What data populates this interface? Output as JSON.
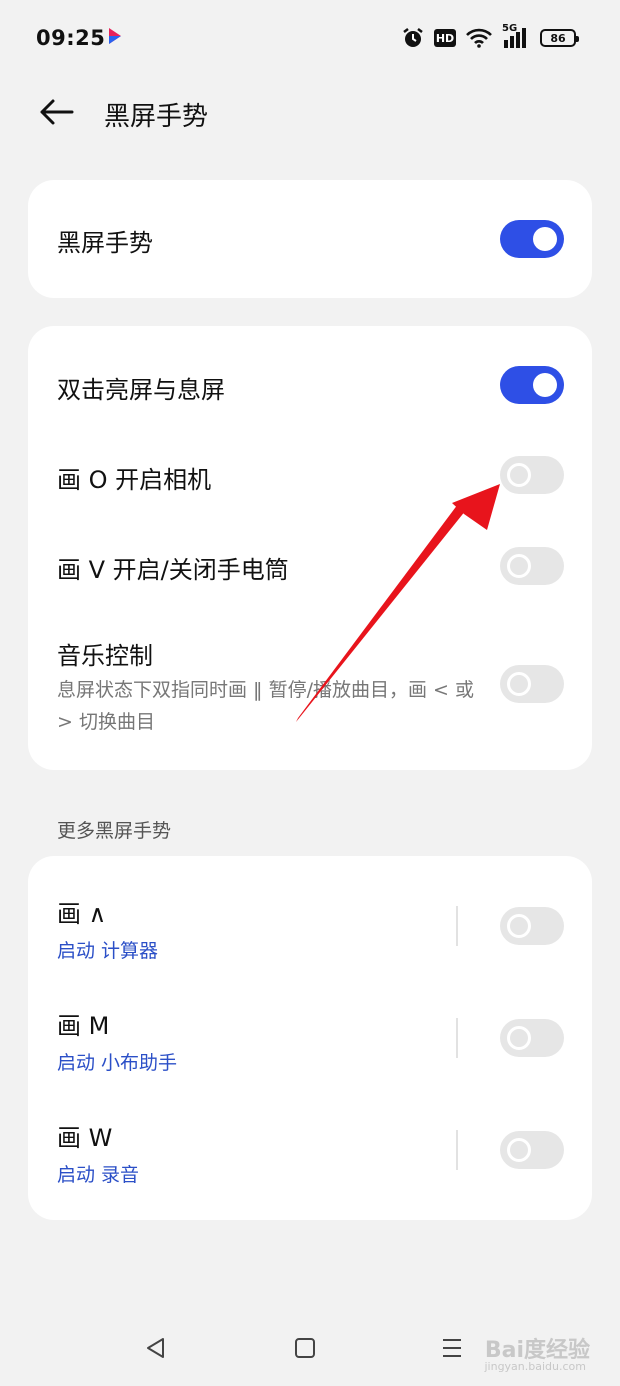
{
  "status": {
    "time": "09:25",
    "signal": "5G",
    "hd": "HD",
    "battery": "86"
  },
  "header": {
    "title": "黑屏手势"
  },
  "master": {
    "label": "黑屏手势",
    "enabled": true
  },
  "gestures": [
    {
      "label": "双击亮屏与息屏",
      "enabled": true
    },
    {
      "label": "画 O 开启相机",
      "enabled": false
    },
    {
      "label": "画 V 开启/关闭手电筒",
      "enabled": false
    },
    {
      "label": "音乐控制",
      "desc": "息屏状态下双指同时画 ‖ 暂停/播放曲目，画 < 或 > 切换曲目",
      "enabled": false
    }
  ],
  "more": {
    "section_label": "更多黑屏手势",
    "items": [
      {
        "label": "画 ∧",
        "action": "启动 计算器",
        "enabled": false
      },
      {
        "label": "画 M",
        "action": "启动 小布助手",
        "enabled": false
      },
      {
        "label": "画 W",
        "action": "启动 录音",
        "enabled": false
      }
    ]
  },
  "watermark": {
    "brand": "Bai度经验",
    "url": "jingyan.baidu.com"
  },
  "colors": {
    "accent": "#2e4fe6",
    "link": "#2b4fc7",
    "annotation_arrow": "#e8141c"
  }
}
